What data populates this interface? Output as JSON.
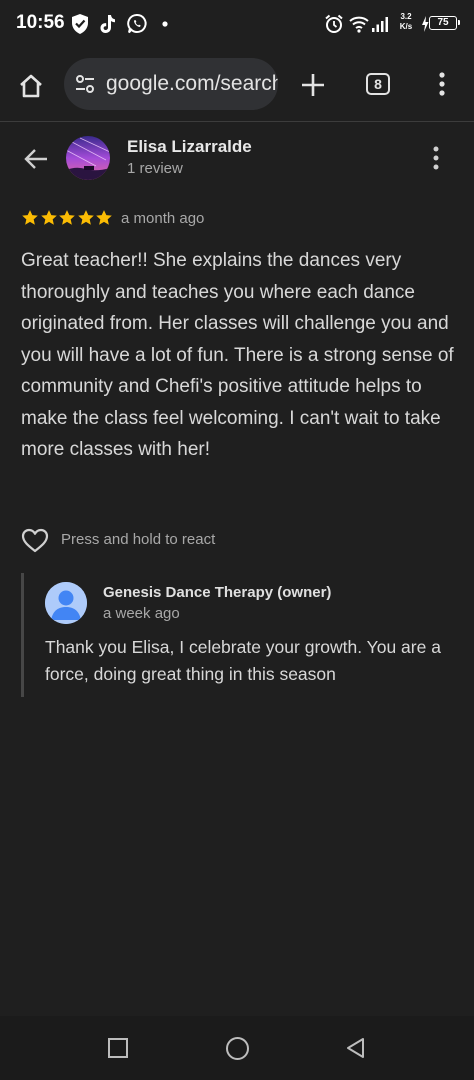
{
  "status_bar": {
    "time": "10:56",
    "net_speed_value": "3.2",
    "net_speed_unit": "K/s",
    "battery": "75",
    "icons": [
      "shield-check-icon",
      "tiktok-icon",
      "whatsapp-icon",
      "dot-icon",
      "alarm-icon",
      "wifi-icon",
      "signal-icon",
      "charging-icon"
    ]
  },
  "browser": {
    "url": "google.com/search",
    "tab_count": "8",
    "icons": [
      "home-icon",
      "site-settings-icon",
      "plus-icon",
      "more-vert-icon"
    ]
  },
  "review": {
    "reviewer_name": "Elisa Lizarralde",
    "reviewer_sub": "1 review",
    "rating": 5,
    "date": "a month ago",
    "text": "Great teacher!! She explains the dances very thoroughly and teaches you where each dance originated from. Her classes will challenge you and you will have a lot of fun. There is a strong sense of community and Chefi's positive attitude helps to make the class feel welcoming. I can't wait to take more classes with her!",
    "react_label": "Press and hold to react"
  },
  "owner_reply": {
    "name": "Genesis Dance Therapy (owner)",
    "date": "a week ago",
    "text": "Thank you Elisa, I celebrate your growth. You are a force, doing great thing in this season"
  },
  "colors": {
    "background": "#1f1f1f",
    "star": "#fbbc04",
    "owner_avatar_bg": "#aecbfa",
    "owner_avatar_fg": "#4285f4"
  }
}
